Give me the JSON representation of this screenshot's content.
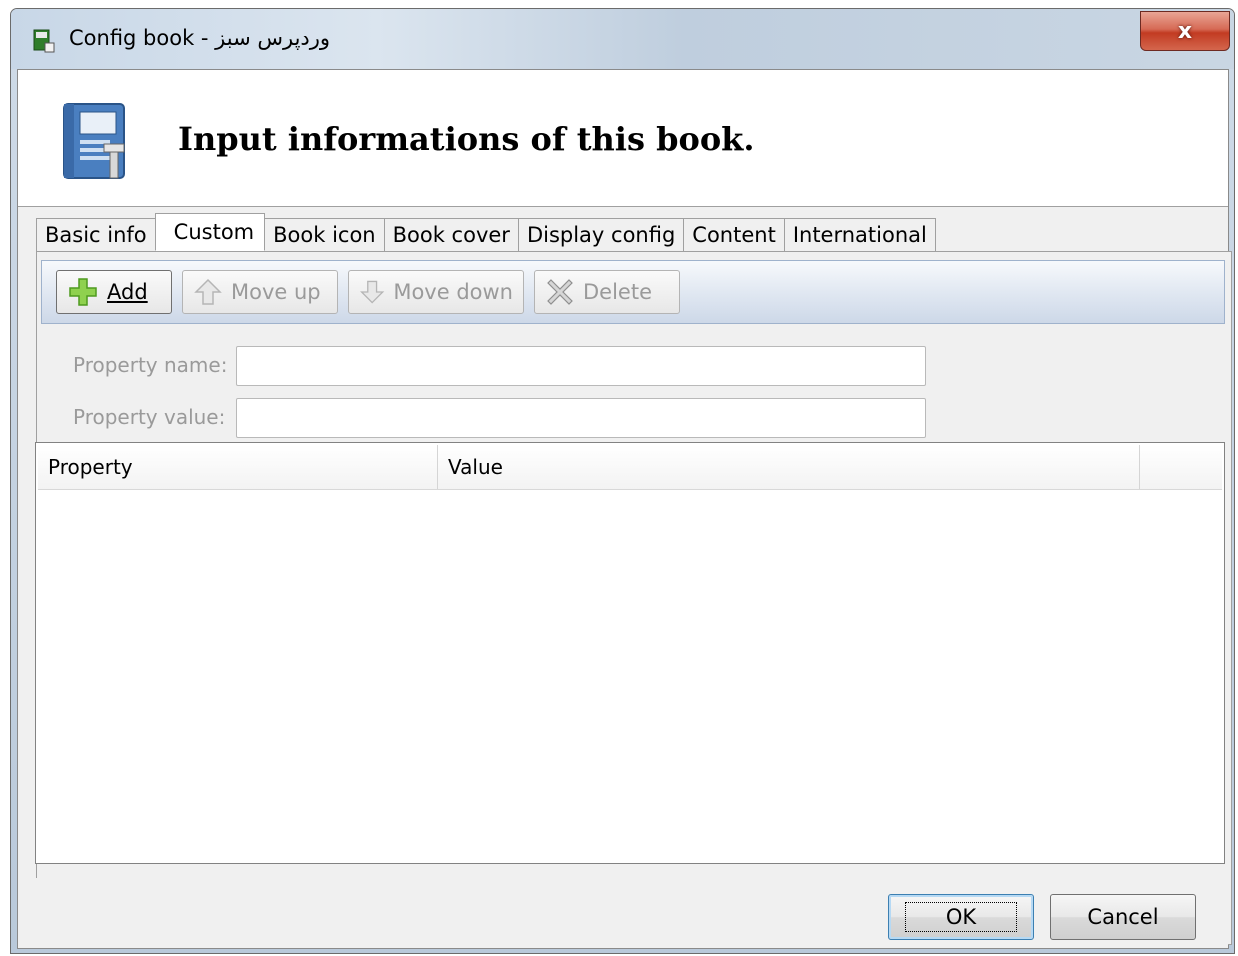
{
  "window": {
    "title": "Config book - وردپرس سبز",
    "close_label": "x"
  },
  "header": {
    "icon": "book-settings-icon",
    "title": "Input informations of this book."
  },
  "tabs": [
    {
      "label": "Basic info",
      "active": false
    },
    {
      "label": "Custom",
      "active": true
    },
    {
      "label": "Book icon",
      "active": false
    },
    {
      "label": "Book cover",
      "active": false
    },
    {
      "label": "Display config",
      "active": false
    },
    {
      "label": "Content",
      "active": false
    },
    {
      "label": "International",
      "active": false
    }
  ],
  "toolbar": {
    "add": {
      "label": "Add",
      "icon": "add-plus-icon",
      "enabled": true
    },
    "move_up": {
      "label": "Move up",
      "icon": "arrow-up-icon",
      "enabled": false
    },
    "move_down": {
      "label": "Move down",
      "icon": "arrow-down-icon",
      "enabled": false
    },
    "delete": {
      "label": "Delete",
      "icon": "delete-x-icon",
      "enabled": false
    }
  },
  "form": {
    "property_name_label": "Property name:",
    "property_name_value": "",
    "property_value_label": "Property value:",
    "property_value_value": ""
  },
  "grid": {
    "columns": [
      "Property",
      "Value"
    ],
    "rows": []
  },
  "buttons": {
    "ok": "OK",
    "cancel": "Cancel"
  },
  "colors": {
    "title_bar": "#c8d7e7",
    "close_button": "#c23b22",
    "toolbar": "#dde6f1",
    "dialog_bg": "#f0f0f0"
  }
}
